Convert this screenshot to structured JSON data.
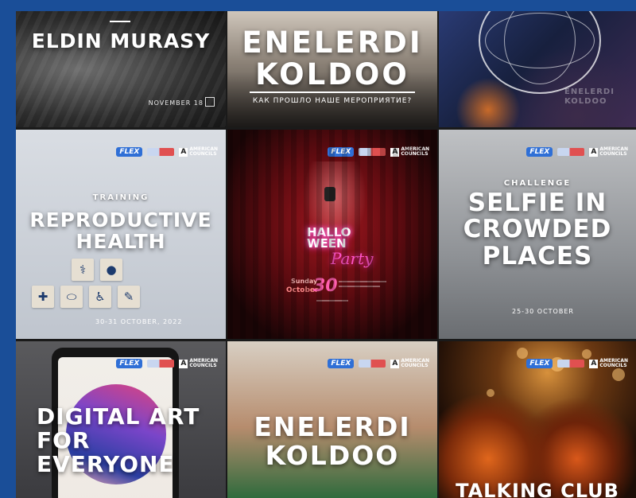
{
  "page": {
    "background_color": "#1a4e98"
  },
  "tiles": [
    {
      "headline": "ELDIN MURASY",
      "date": "NOVEMBER 18"
    },
    {
      "headline": "ENELERDI\nKOLDOO",
      "subline": "КАК ПРОШЛО НАШЕ МЕРОПРИЯТИЕ?"
    },
    {
      "background_text": "ENELERDI KOLDOO"
    },
    {
      "logos": {
        "flex": "FLEX",
        "ac": "AMERICAN\nCOUNCILS"
      },
      "kicker": "TRAINING",
      "headline": "REPRODUCTIVE\nHEALTH",
      "date": "30-31 OCTOBER, 2022"
    },
    {
      "logos": {
        "flex": "FLEX",
        "ac": "AMERICAN\nCOUNCILS"
      },
      "neon": "HALLO\nWEEN",
      "party": "Party",
      "day_label": "Sunday",
      "month": "October",
      "day": "30"
    },
    {
      "logos": {
        "flex": "FLEX",
        "ac": "AMERICAN\nCOUNCILS"
      },
      "kicker": "CHALLENGE",
      "headline": "SELFIE IN\nCROWDED\nPLACES",
      "date": "25-30 OCTOBER"
    },
    {
      "logos": {
        "flex": "FLEX",
        "ac": "AMERICAN\nCOUNCILS"
      },
      "headline": "DIGITAL ART\nFOR\nEVERYONE"
    },
    {
      "logos": {
        "flex": "FLEX",
        "ac": "AMERICAN\nCOUNCILS"
      },
      "headline": "ENELERDI\nKOLDOO"
    },
    {
      "logos": {
        "flex": "FLEX",
        "ac": "AMERICAN\nCOUNCILS"
      },
      "headline": "TALKING CLUB"
    }
  ]
}
